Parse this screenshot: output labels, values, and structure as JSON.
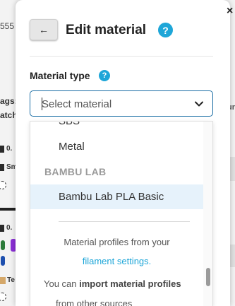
{
  "modal": {
    "title": "Edit material",
    "close_symbol": "×",
    "back_symbol": "←"
  },
  "material_type": {
    "label": "Material type",
    "placeholder": "Select material"
  },
  "dropdown": {
    "partial_option": "SBS",
    "options": [
      "Metal"
    ],
    "group": {
      "header": "BAMBU LAB",
      "items": [
        "Bambu Lab PLA Basic"
      ]
    },
    "info_text": "Material profiles from your",
    "info_link": "filament settings.",
    "import_prefix": "You can ",
    "import_bold": "import material profiles",
    "import_cut": "from other sources"
  },
  "background": {
    "frag_top": "555",
    "frag_ags": "ags:",
    "frag_atch": "atch",
    "frag_0a": "0.",
    "frag_sm": "Sm",
    "frag_0b": "0.",
    "frag_te": "Te",
    "frag_ur": "ur"
  },
  "colors": {
    "accent": "#1ea6d8",
    "select_border": "#1d6fa5",
    "highlight": "#e6f2fb",
    "group_header": "#9a9a9a"
  }
}
